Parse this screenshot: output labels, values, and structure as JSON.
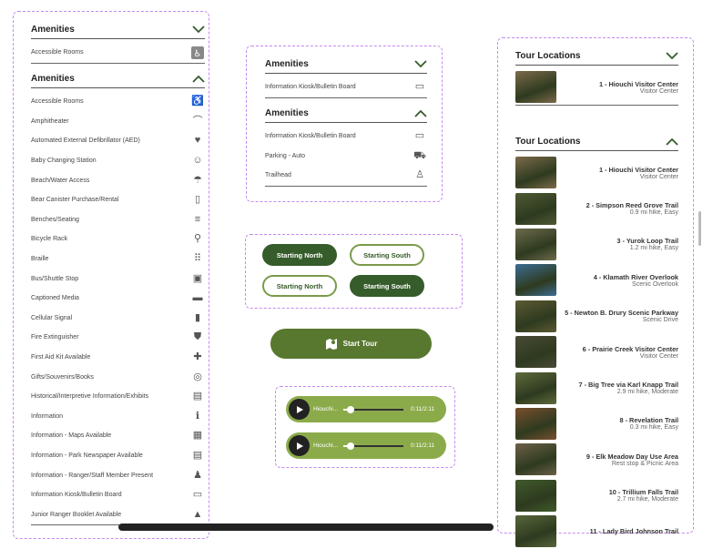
{
  "colors": {
    "accent_dark": "#355c2a",
    "accent": "#58782f",
    "accent_light": "#8bab4b",
    "frame": "#c58af0"
  },
  "left": {
    "collapsed": {
      "title": "Amenities",
      "items": [
        {
          "label": "Accessible Rooms",
          "icon": "wheelchair-icon"
        }
      ]
    },
    "expanded": {
      "title": "Amenities",
      "items": [
        {
          "label": "Accessible Rooms",
          "icon": "wheelchair-icon"
        },
        {
          "label": "Amphitheater",
          "icon": "amphitheater-icon"
        },
        {
          "label": "Automated External Defibrillator (AED)",
          "icon": "heart-pulse-icon"
        },
        {
          "label": "Baby Changing Station",
          "icon": "baby-changing-icon"
        },
        {
          "label": "Beach/Water Access",
          "icon": "umbrella-beach-icon"
        },
        {
          "label": "Bear Canister Purchase/Rental",
          "icon": "canister-icon"
        },
        {
          "label": "Benches/Seating",
          "icon": "bench-icon"
        },
        {
          "label": "Bicycle Rack",
          "icon": "bicycle-icon"
        },
        {
          "label": "Braille",
          "icon": "braille-icon"
        },
        {
          "label": "Bus/Shuttle Stop",
          "icon": "bus-icon"
        },
        {
          "label": "Captioned Media",
          "icon": "caption-icon"
        },
        {
          "label": "Cellular Signal",
          "icon": "signal-icon"
        },
        {
          "label": "Fire Extinguisher",
          "icon": "fire-extinguisher-icon"
        },
        {
          "label": "First Aid Kit Available",
          "icon": "first-aid-icon"
        },
        {
          "label": "Gifts/Souvenirs/Books",
          "icon": "gift-shop-icon"
        },
        {
          "label": "Historical/Interpretive Information/Exhibits",
          "icon": "exhibit-icon"
        },
        {
          "label": "Information",
          "icon": "info-icon"
        },
        {
          "label": "Information - Maps Available",
          "icon": "map-icon"
        },
        {
          "label": "Information - Park Newspaper Available",
          "icon": "newspaper-icon"
        },
        {
          "label": "Information - Ranger/Staff Member Present",
          "icon": "ranger-icon"
        },
        {
          "label": "Information Kiosk/Bulletin Board",
          "icon": "kiosk-icon"
        },
        {
          "label": "Junior Ranger Booklet Available",
          "icon": "ranger-hat-icon"
        }
      ]
    }
  },
  "middle": {
    "collapsed": {
      "title": "Amenities",
      "items": [
        {
          "label": "Information Kiosk/Bulletin Board",
          "icon": "kiosk-icon"
        }
      ]
    },
    "expanded": {
      "title": "Amenities",
      "items": [
        {
          "label": "Information Kiosk/Bulletin Board",
          "icon": "kiosk-icon"
        },
        {
          "label": "Parking - Auto",
          "icon": "car-icon"
        },
        {
          "label": "Trailhead",
          "icon": "hiker-icon"
        }
      ]
    }
  },
  "start_buttons": {
    "north_label": "Starting North",
    "south_label": "Starting South"
  },
  "start_tour": {
    "label": "Start Tour",
    "icon": "map-pin-icon"
  },
  "audio": [
    {
      "title": "Hiouchi...",
      "time": "0:11/2:11",
      "progress": 0.08
    },
    {
      "title": "Hiouchi...",
      "time": "0:11/2:11",
      "progress": 0.08
    }
  ],
  "tour": {
    "collapsed": {
      "title": "Tour Locations",
      "items": [
        {
          "name": "1 - Hiouchi Visitor Center",
          "sub": "Visitor Center",
          "thumb": "#7c6a4a"
        }
      ]
    },
    "expanded": {
      "title": "Tour Locations",
      "items": [
        {
          "name": "1 - Hiouchi Visitor Center",
          "sub": "Visitor Center",
          "thumb": "#7c6a4a"
        },
        {
          "name": "2 - Simpson Reed Grove Trail",
          "sub": "0.9 mi hike, Easy",
          "thumb": "#4e5a32"
        },
        {
          "name": "3 - Yurok Loop Trail",
          "sub": "1.2 mi hike, Easy",
          "thumb": "#6d6b4c"
        },
        {
          "name": "4 - Klamath River Overlook",
          "sub": "Scenic Overlook",
          "thumb": "#3c6d93"
        },
        {
          "name": "5 - Newton B. Drury Scenic Parkway",
          "sub": "Scenic Drive",
          "thumb": "#5c5a33"
        },
        {
          "name": "6 - Prairie Creek Visitor Center",
          "sub": "Visitor Center",
          "thumb": "#4a4a36"
        },
        {
          "name": "7 - Big Tree via Karl Knapp Trail",
          "sub": "2.9 mi hike, Moderate",
          "thumb": "#5f6a3b"
        },
        {
          "name": "8 - Revelation Trail",
          "sub": "0.3 mi hike, Easy",
          "thumb": "#7a4f2e"
        },
        {
          "name": "9 - Elk Meadow Day Use Area",
          "sub": "Rest stop & Picnic Area",
          "thumb": "#6c6148"
        },
        {
          "name": "10 - Trillium Falls Trail",
          "sub": "2.7 mi hike, Moderate",
          "thumb": "#3f5a2b"
        },
        {
          "name": "11 - Lady Bird Johnson Trail",
          "sub": "",
          "thumb": "#58663a"
        }
      ]
    }
  }
}
